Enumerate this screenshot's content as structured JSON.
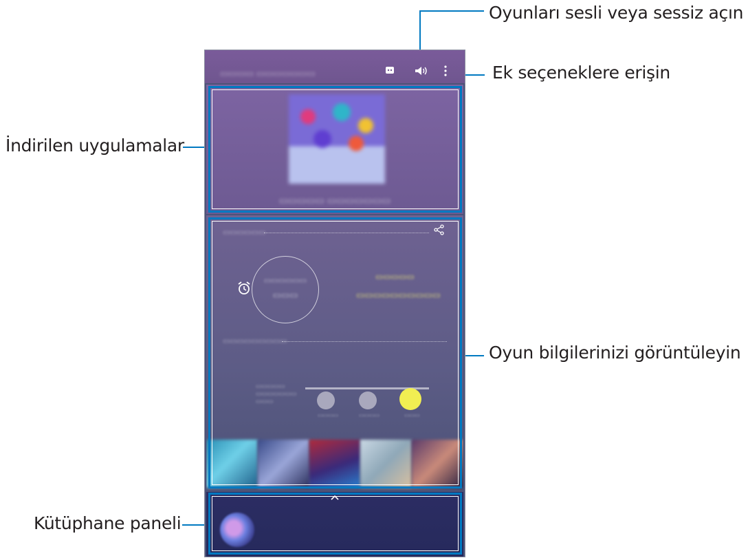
{
  "callouts": {
    "sound": "Oyunları sesli veya sessiz açın",
    "more_options": "Ek seçeneklere erişin",
    "downloaded_apps": "İndirilen uygulamalar",
    "game_info": "Oyun bilgilerinizi görüntüleyin",
    "library_panel": "Kütüphane paneli"
  },
  "colors": {
    "callout_line": "#0079c1",
    "topbar": "#7a5b9a",
    "highlight_knob": "#f1ee52",
    "library_bg": "#2c2d63"
  },
  "icons": {
    "discord": "discord-icon",
    "volume": "volume-icon",
    "more": "more-vertical-icon",
    "share": "share-icon",
    "alarm": "alarm-clock-icon",
    "expand": "chevron-up-icon"
  }
}
